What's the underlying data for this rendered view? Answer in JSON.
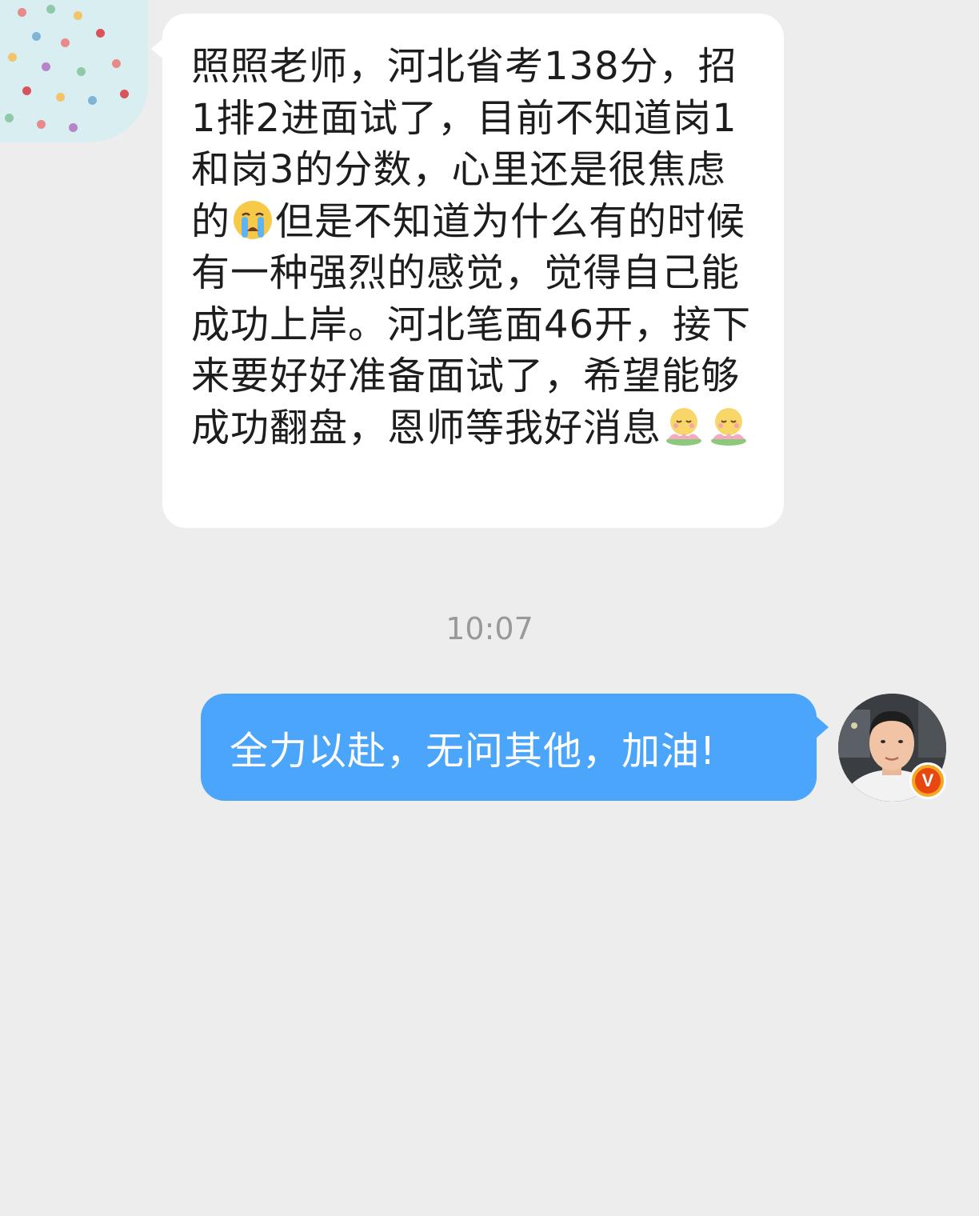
{
  "conversation": {
    "incoming": {
      "segments": [
        "照照老师，河北省考138分，招1排2进面试了，目前不知道岗1和岗3的分数，心里还是很焦虑的",
        "但是不知道为什么有的时候有一种强烈的感觉，觉得自己能成功上岸。河北笔面46开，接下来要好好准备面试了，希望能够成功翻盘，恩师等我好消息"
      ],
      "emoji_mid": "crying-face-emoji",
      "emoji_end": [
        "lotus-smile-emoji",
        "lotus-smile-emoji"
      ]
    },
    "timestamp": "10:07",
    "outgoing": {
      "text": "全力以赴，无问其他，加油!"
    },
    "verify_badge": "V"
  },
  "colors": {
    "background": "#ededed",
    "incoming_bubble": "#ffffff",
    "outgoing_bubble": "#4ba5fb",
    "timestamp": "#999999",
    "badge": "#e8470f"
  }
}
